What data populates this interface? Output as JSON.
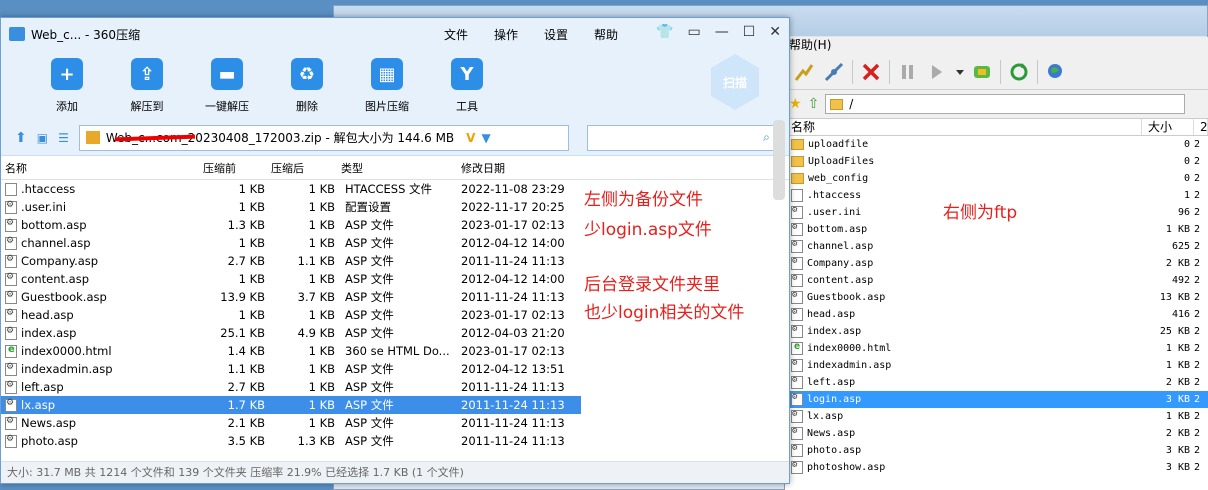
{
  "zip": {
    "title": "Web_c... - 360压缩",
    "menus": [
      "文件",
      "操作",
      "设置",
      "帮助"
    ],
    "tools": [
      {
        "label": "添加",
        "icon": "plus-icon"
      },
      {
        "label": "解压到",
        "icon": "extract-icon"
      },
      {
        "label": "一键解压",
        "icon": "one-click-extract-icon"
      },
      {
        "label": "删除",
        "icon": "trash-icon"
      },
      {
        "label": "图片压缩",
        "icon": "image-compress-icon"
      },
      {
        "label": "工具",
        "icon": "tools-icon"
      }
    ],
    "scan_label": "扫描",
    "path": "Web_c...com_20230408_172003.zip - 解包大小为 144.6 MB",
    "columns": [
      "名称",
      "压缩前",
      "压缩后",
      "类型",
      "修改日期"
    ],
    "files": [
      {
        "name": ".htaccess",
        "before": "1 KB",
        "after": "1 KB",
        "type": "HTACCESS 文件",
        "date": "2022-11-08 23:29",
        "icon": "file"
      },
      {
        "name": ".user.ini",
        "before": "1 KB",
        "after": "1 KB",
        "type": "配置设置",
        "date": "2022-11-17 20:25",
        "icon": "asp"
      },
      {
        "name": "bottom.asp",
        "before": "1.3 KB",
        "after": "1 KB",
        "type": "ASP 文件",
        "date": "2023-01-17 02:13",
        "icon": "asp"
      },
      {
        "name": "channel.asp",
        "before": "1 KB",
        "after": "1 KB",
        "type": "ASP 文件",
        "date": "2012-04-12 14:00",
        "icon": "asp"
      },
      {
        "name": "Company.asp",
        "before": "2.7 KB",
        "after": "1.1 KB",
        "type": "ASP 文件",
        "date": "2011-11-24 11:13",
        "icon": "asp"
      },
      {
        "name": "content.asp",
        "before": "1 KB",
        "after": "1 KB",
        "type": "ASP 文件",
        "date": "2012-04-12 14:00",
        "icon": "asp"
      },
      {
        "name": "Guestbook.asp",
        "before": "13.9 KB",
        "after": "3.7 KB",
        "type": "ASP 文件",
        "date": "2011-11-24 11:13",
        "icon": "asp"
      },
      {
        "name": "head.asp",
        "before": "1 KB",
        "after": "1 KB",
        "type": "ASP 文件",
        "date": "2023-01-17 02:13",
        "icon": "asp"
      },
      {
        "name": "index.asp",
        "before": "25.1 KB",
        "after": "4.9 KB",
        "type": "ASP 文件",
        "date": "2012-04-03 21:20",
        "icon": "asp"
      },
      {
        "name": "index0000.html",
        "before": "1.4 KB",
        "after": "1 KB",
        "type": "360 se HTML Do...",
        "date": "2023-01-17 02:13",
        "icon": "html"
      },
      {
        "name": "indexadmin.asp",
        "before": "1.1 KB",
        "after": "1 KB",
        "type": "ASP 文件",
        "date": "2012-04-12 13:51",
        "icon": "asp"
      },
      {
        "name": "left.asp",
        "before": "2.7 KB",
        "after": "1 KB",
        "type": "ASP 文件",
        "date": "2011-11-24 11:13",
        "icon": "asp"
      },
      {
        "name": "lx.asp",
        "before": "1.7 KB",
        "after": "1 KB",
        "type": "ASP 文件",
        "date": "2011-11-24 11:13",
        "icon": "asp",
        "selected": true
      },
      {
        "name": "News.asp",
        "before": "2.1 KB",
        "after": "1 KB",
        "type": "ASP 文件",
        "date": "2011-11-24 11:13",
        "icon": "asp"
      },
      {
        "name": "photo.asp",
        "before": "3.5 KB",
        "after": "1.3 KB",
        "type": "ASP 文件",
        "date": "2011-11-24 11:13",
        "icon": "asp"
      }
    ],
    "status": "大小: 31.7 MB 共 1214 个文件和 139 个文件夹 压缩率 21.9% 已经选择 1.7 KB (1 个文件)"
  },
  "notes": {
    "left_line1": "左侧为备份文件",
    "left_line2": "少login.asp文件",
    "left_line3": "后台登录文件夹里",
    "left_line4": "也少login相关的文件",
    "right": "右侧为ftp"
  },
  "ftp": {
    "menu": "帮助(H)",
    "path": "/",
    "columns": [
      "名称",
      "大小",
      "2"
    ],
    "files": [
      {
        "name": "uploadfile",
        "size": "0",
        "icon": "folder"
      },
      {
        "name": "UploadFiles",
        "size": "0",
        "icon": "folder"
      },
      {
        "name": "web_config",
        "size": "0",
        "icon": "folder"
      },
      {
        "name": ".htaccess",
        "size": "1",
        "icon": "file"
      },
      {
        "name": ".user.ini",
        "size": "96",
        "icon": "asp"
      },
      {
        "name": "bottom.asp",
        "size": "1 KB",
        "icon": "asp"
      },
      {
        "name": "channel.asp",
        "size": "625",
        "icon": "asp"
      },
      {
        "name": "Company.asp",
        "size": "2 KB",
        "icon": "asp"
      },
      {
        "name": "content.asp",
        "size": "492",
        "icon": "asp"
      },
      {
        "name": "Guestbook.asp",
        "size": "13 KB",
        "icon": "asp"
      },
      {
        "name": "head.asp",
        "size": "416",
        "icon": "asp"
      },
      {
        "name": "index.asp",
        "size": "25 KB",
        "icon": "asp"
      },
      {
        "name": "index0000.html",
        "size": "1 KB",
        "icon": "html"
      },
      {
        "name": "indexadmin.asp",
        "size": "1 KB",
        "icon": "asp"
      },
      {
        "name": "left.asp",
        "size": "2 KB",
        "icon": "asp"
      },
      {
        "name": "login.asp",
        "size": "3 KB",
        "icon": "asp",
        "selected": true
      },
      {
        "name": "lx.asp",
        "size": "1 KB",
        "icon": "asp"
      },
      {
        "name": "News.asp",
        "size": "2 KB",
        "icon": "asp"
      },
      {
        "name": "photo.asp",
        "size": "3 KB",
        "icon": "asp"
      },
      {
        "name": "photoshow.asp",
        "size": "3 KB",
        "icon": "asp"
      }
    ]
  }
}
